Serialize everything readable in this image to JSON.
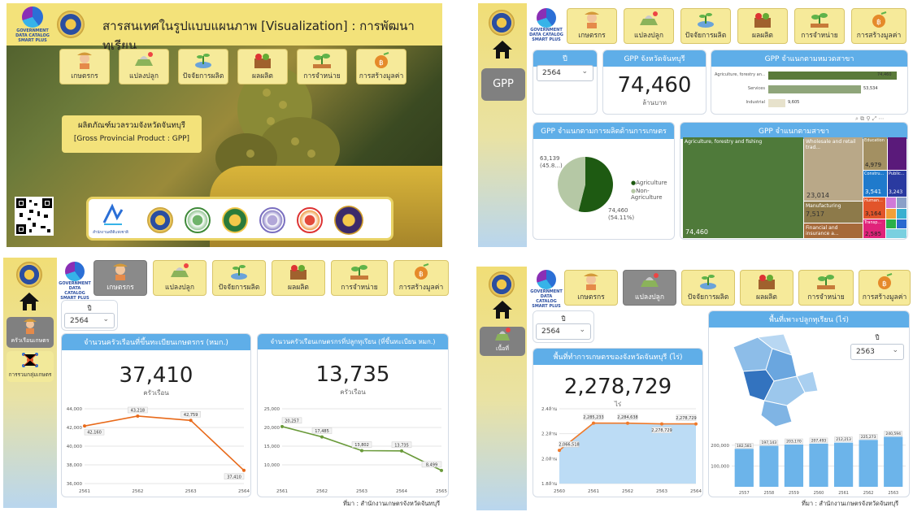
{
  "p1": {
    "title": "สารสนเทศในรูปแบบแผนภาพ [Visualization] : การพัฒนาทุเรียน",
    "gov_caption": "GOVERNMENT DATA CATALOG SMART PLUS",
    "tiles": [
      "เกษตรกร",
      "แปลงปลูก",
      "ปัจจัยการผลิต",
      "ผลผลิต",
      "การจำหน่าย",
      "การสร้างมูลค่า"
    ],
    "gpp_line1": "ผลิตภัณฑ์มวลรวมจังหวัดจันทบุรี",
    "gpp_line2": "[Gross Provincial Product : GPP]",
    "logo_caption": "สำนักงานสถิติแห่งชาติ"
  },
  "p2": {
    "gov_caption": "GOVERNMENT DATA CATALOG SMART PLUS",
    "tiles": [
      "เกษตรกร",
      "แปลงปลูก",
      "ปัจจัยการผลิต",
      "ผลผลิต",
      "การจำหน่าย",
      "การสร้างมูลค่า"
    ],
    "gpp_button": "GPP",
    "year_label": "ปี",
    "year_value": "2564",
    "kpi_title": "GPP จังหวัดจันทบุรี",
    "kpi_value": "74,460",
    "kpi_unit": "ล้านบาท",
    "sector_title": "GPP จำแนกตามหมวดสาขา",
    "sector_bars": [
      {
        "label": "Agriculture, forestry an...",
        "value": "74,460",
        "frac": 1.0
      },
      {
        "label": "Services",
        "value": "53,534",
        "frac": 0.72
      },
      {
        "label": "Industrial",
        "value": "9,605",
        "frac": 0.13
      }
    ],
    "pie_title": "GPP จำแนกตามการผลิตด้านการเกษตร",
    "pie_a_label": "63,139",
    "pie_a_pct": "(45.8...)",
    "pie_b_label": "74,460",
    "pie_b_pct": "(54.11%)",
    "legend_ag": "Agriculture",
    "legend_nonag": "Non-Agriculture",
    "tree_title": "GPP จำแนกตามสาขา",
    "tree": {
      "agri_label": "Agriculture, forestry and fishing",
      "agri_value": "74,460",
      "whole_label": "Wholesale and retail trad...",
      "whole_value": "23,014",
      "manu_label": "Manufacturing",
      "manu_value": "7,517",
      "fin_label": "Financial and insurance a...",
      "edu_label": "Education",
      "edu_value": "4,979",
      "cons_label": "Constru...",
      "cons_value": "3,541",
      "hum_label": "Human...",
      "hum_value": "3,164",
      "tran_label": "Transp...",
      "tran_value": "2,585",
      "pub_label": "Public...",
      "pub_value": "3,243"
    }
  },
  "p3": {
    "gov_caption": "GOVERNMENT DATA CATALOG SMART PLUS",
    "tiles": [
      "เกษตรกร",
      "แปลงปลูก",
      "ปัจจัยการผลิต",
      "ผลผลิต",
      "การจำหน่าย",
      "การสร้างมูลค่า"
    ],
    "side_btn1": "ครัวเรือนเกษตร",
    "side_btn2": "การรวมกลุ่มเกษตร",
    "year_label": "ปี",
    "year_value": "2564",
    "card1_title": "จำนวนครัวเรือนที่ขึ้นทะเบียนเกษตรกร (หมก.)",
    "card1_value": "37,410",
    "card1_unit": "ครัวเรือน",
    "card2_title": "จำนวนครัวเรือนเกษตรกรที่ปลูกทุเรียน (ที่ขึ้นทะเบียน หมก.)",
    "card2_value": "13,735",
    "card2_unit": "ครัวเรือน",
    "source": "ที่มา : สำนักงานเกษตรจังหวัดจันทบุรี"
  },
  "p4": {
    "gov_caption": "GOVERNMENT DATA CATALOG SMART PLUS",
    "tiles": [
      "เกษตรกร",
      "แปลงปลูก",
      "ปัจจัยการผลิต",
      "ผลผลิต",
      "การจำหน่าย",
      "การสร้างมูลค่า"
    ],
    "side_btn": "เนื้อที่",
    "year_label": "ปี",
    "year_value": "2564",
    "card1_title": "พื้นที่ทำการเกษตรของจังหวัดจันทบุรี (ไร่)",
    "card1_value": "2,278,729",
    "card1_unit": "ไร่",
    "card2_title": "พื้นที่เพาะปลูกทุเรียน (ไร่)",
    "card2_year_label": "ปี",
    "card2_year_value": "2563",
    "source": "ที่มา : สำนักงานเกษตรจังหวัดจันทบุรี"
  },
  "chart_data": [
    {
      "type": "bar",
      "title": "GPP จำแนกตามหมวดสาขา",
      "categories": [
        "Agriculture, forestry an...",
        "Services",
        "Industrial"
      ],
      "values": [
        74460,
        53534,
        9605
      ]
    },
    {
      "type": "pie",
      "title": "GPP จำแนกตามการผลิตด้านการเกษตร",
      "categories": [
        "Agriculture",
        "Non-Agriculture"
      ],
      "values": [
        74460,
        63139
      ]
    },
    {
      "type": "line",
      "title": "จำนวนครัวเรือนที่ขึ้นทะเบียนเกษตรกร (หมก.)",
      "x": [
        "2561",
        "2562",
        "2563",
        "2564"
      ],
      "values": [
        42160,
        43218,
        42759,
        37410
      ],
      "ylim": [
        36000,
        44000
      ],
      "yticks": [
        "36,000",
        "38,000",
        "40,000",
        "42,000",
        "44,000"
      ],
      "point_labels": [
        "42,160",
        "43,218",
        "42,759",
        "37,410"
      ]
    },
    {
      "type": "line",
      "title": "จำนวนครัวเรือนเกษตรกรที่ปลูกทุเรียน (ที่ขึ้นทะเบียน หมก.)",
      "x": [
        "2561",
        "2562",
        "2563",
        "2564",
        "2565"
      ],
      "values": [
        20257,
        17485,
        13802,
        13735,
        8499
      ],
      "ylim": [
        5000,
        25000
      ],
      "yticks": [
        "10,000",
        "15,000",
        "20,000",
        "25,000"
      ],
      "point_labels": [
        "20,257",
        "17,485",
        "13,802",
        "13,735",
        "8,499"
      ]
    },
    {
      "type": "area",
      "title": "พื้นที่ทำการเกษตรของจังหวัดจันทบุรี (ไร่)",
      "x": [
        "2560",
        "2561",
        "2562",
        "2563",
        "2564"
      ],
      "values": [
        2066518,
        2285233,
        2284638,
        2278729,
        2278729
      ],
      "ylim": [
        1800000,
        2400000
      ],
      "yticks": [
        "1.8ล้าน",
        "2.0ล้าน",
        "2.2ล้าน",
        "2.4ล้าน"
      ],
      "point_labels": [
        "2,066,518",
        "2,285,233",
        "2,284,638",
        "2,278,729",
        "2,278,729"
      ]
    },
    {
      "type": "bar",
      "title": "พื้นที่เพาะปลูกทุเรียน (ไร่)",
      "categories": [
        "2557",
        "2558",
        "2559",
        "2560",
        "2561",
        "2562",
        "2563"
      ],
      "values": [
        182581,
        197143,
        203170,
        207493,
        212213,
        225273,
        240594
      ],
      "ylim": [
        0,
        250000
      ],
      "yticks": [
        "100,000",
        "200,000"
      ],
      "point_labels": [
        "182,581",
        "197,143",
        "203,170",
        "207,493",
        "212,213",
        "225,273",
        "240,594"
      ]
    }
  ]
}
